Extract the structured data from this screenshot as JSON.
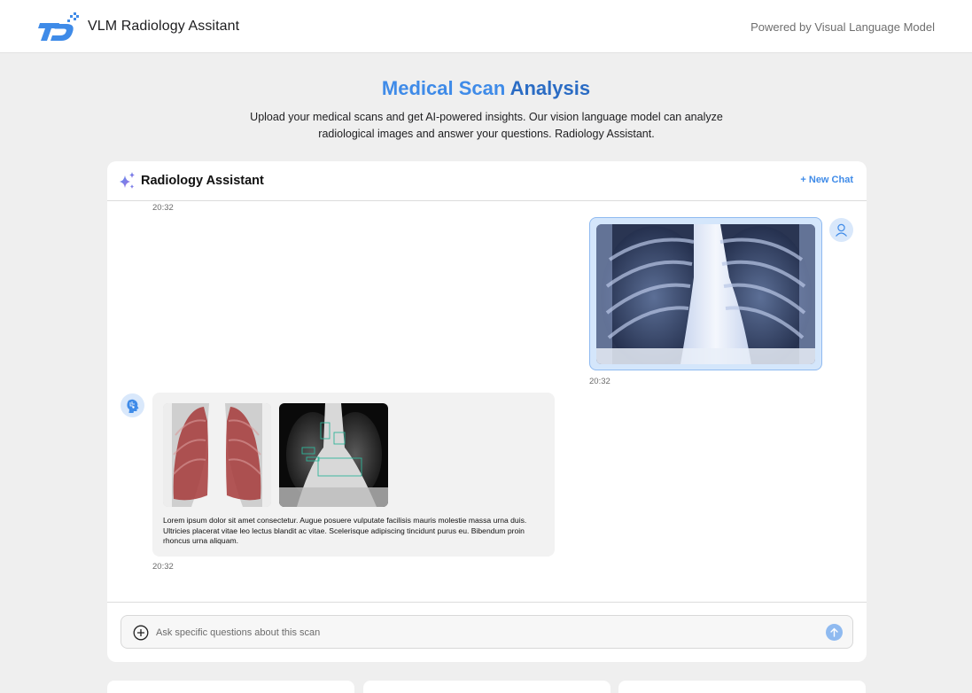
{
  "header": {
    "app_title": "VLM Radiology Assitant",
    "powered_by": "Powered by Visual Language Model",
    "logo_icon": "td-logo-icon"
  },
  "hero": {
    "title_part1": "Medical Scan ",
    "title_part2": "Analysis",
    "description": "Upload your medical scans and get AI-powered insights. Our vision language model can analyze radiological images and answer your questions. Radiology Assistant."
  },
  "chat": {
    "title": "Radiology Assistant",
    "title_icon": "sparkle-icon",
    "new_chat_label": "+ New Chat",
    "messages": [
      {
        "role": "user",
        "type": "image",
        "content": "chest-xray",
        "time": "20:32"
      },
      {
        "role": "assistant",
        "type": "images-and-text",
        "images": [
          "lung-segmentation",
          "annotated-xray"
        ],
        "text": "Lorem ipsum dolor sit amet consectetur. Augue posuere vulputate facilisis mauris molestie massa urna duis. Ultricies placerat vitae leo lectus blandit ac vitae. Scelerisque adipiscing tincidunt purus eu. Bibendum proin rhoncus urna aliquam.",
        "time": "20:32"
      }
    ],
    "top_time": "20:32",
    "input": {
      "placeholder": "Ask specific questions about this scan",
      "value": ""
    }
  },
  "colors": {
    "accent": "#3f8be8",
    "accent_dark": "#2b6cc4",
    "background": "#efefef",
    "bubble": "#f2f2f2",
    "send_button": "#8fbaf0"
  }
}
